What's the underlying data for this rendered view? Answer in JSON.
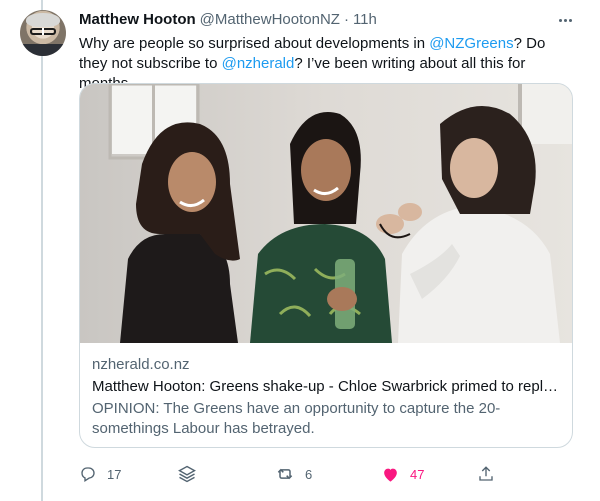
{
  "tweet": {
    "display_name": "Matthew Hooton",
    "handle": "@MatthewHootonNZ",
    "separator": "·",
    "time": "11h",
    "text_parts": {
      "p1": "Why are people so surprised about developments in ",
      "mention1": "@NZGreens",
      "p2": "? Do they not subscribe to ",
      "mention2": "@nzherald",
      "p3": "? I’ve been writing about all this for months."
    }
  },
  "card": {
    "domain": "nzherald.co.nz",
    "title": "Matthew Hooton: Greens shake-up - Chloe Swarbrick primed to repla...",
    "description": "OPINION: The Greens have an opportunity to capture the 20-somethings Labour has betrayed."
  },
  "actions": {
    "reply_count": "17",
    "retweet_count": "6",
    "like_count": "47"
  },
  "icons": {
    "more": "more-icon",
    "reply": "reply-icon",
    "stack": "layers-icon",
    "retweet": "retweet-icon",
    "like": "heart-icon",
    "share": "share-icon"
  },
  "colors": {
    "accent": "#1d9bf0",
    "like": "#f91880",
    "secondary_text": "#536471",
    "border": "#cfd9de"
  }
}
